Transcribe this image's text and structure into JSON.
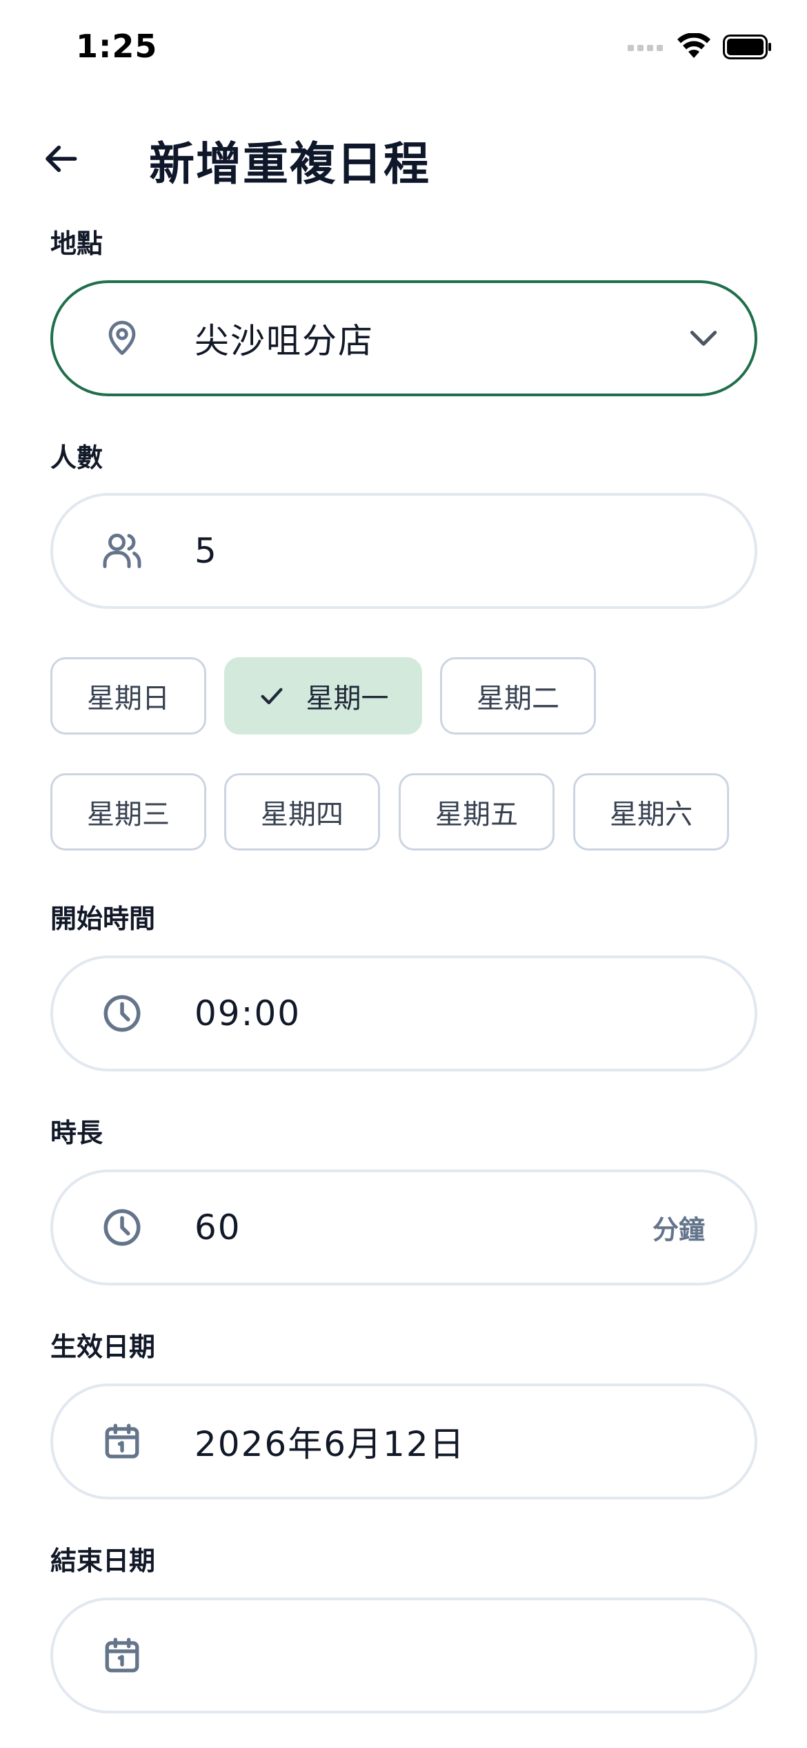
{
  "status_bar": {
    "time": "1:25"
  },
  "header": {
    "back_icon": "arrow-left-icon",
    "title": "新增重複日程"
  },
  "location": {
    "label": "地點",
    "icon": "map-pin-icon",
    "value": "尖沙咀分店",
    "chevron_icon": "chevron-down-icon"
  },
  "people": {
    "label": "人數",
    "icon": "users-icon",
    "value": "5"
  },
  "weekdays": [
    {
      "label": "星期日",
      "selected": false
    },
    {
      "label": "星期一",
      "selected": true
    },
    {
      "label": "星期二",
      "selected": false
    },
    {
      "label": "星期三",
      "selected": false
    },
    {
      "label": "星期四",
      "selected": false
    },
    {
      "label": "星期五",
      "selected": false
    },
    {
      "label": "星期六",
      "selected": false
    }
  ],
  "start_time": {
    "label": "開始時間",
    "icon": "clock-icon",
    "value": "09:00"
  },
  "duration": {
    "label": "時長",
    "icon": "clock-icon",
    "value": "60",
    "suffix": "分鐘"
  },
  "effective_date": {
    "label": "生效日期",
    "icon": "calendar-icon",
    "value": "2026年6月12日"
  },
  "end_date": {
    "label": "結束日期",
    "icon": "calendar-icon",
    "value": ""
  },
  "colors": {
    "accent": "#1f6f4a",
    "selected_chip_bg": "#d3e9dc",
    "border": "#e2e8f0",
    "icon": "#64748b"
  }
}
